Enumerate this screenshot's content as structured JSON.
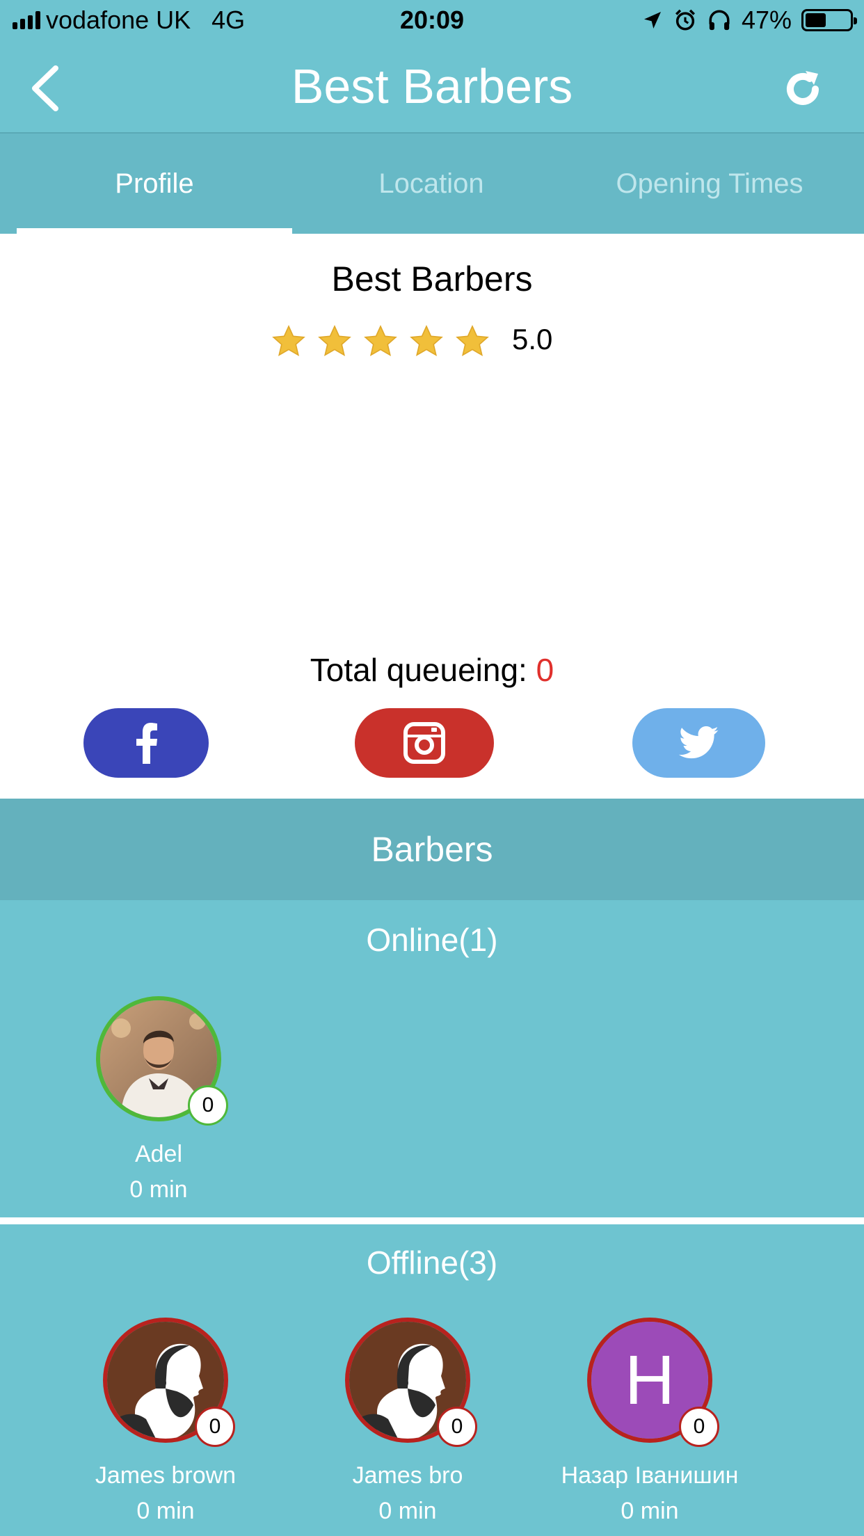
{
  "status_bar": {
    "carrier": "vodafone UK",
    "network": "4G",
    "time": "20:09",
    "battery": "47%",
    "battery_level": 0.47
  },
  "nav": {
    "title": "Best Barbers",
    "back_icon": "chevron-left-icon",
    "refresh_icon": "refresh-icon"
  },
  "tabs": [
    {
      "label": "Profile",
      "active": true
    },
    {
      "label": "Location",
      "active": false
    },
    {
      "label": "Opening Times",
      "active": false
    }
  ],
  "profile": {
    "name": "Best Barbers",
    "rating": "5.0",
    "stars": 5,
    "queue_label": "Total queueing: ",
    "queue_count": "0"
  },
  "social": {
    "facebook_icon": "facebook-icon",
    "instagram_icon": "instagram-icon",
    "twitter_icon": "twitter-icon"
  },
  "colors": {
    "primary": "#6ec4d0",
    "facebook": "#3a45b8",
    "instagram": "#c9312b",
    "twitter": "#6fb0ea",
    "online": "#4fb83a",
    "offline": "#b8221e",
    "queue_count": "#e0302c"
  },
  "barbers": {
    "title": "Barbers",
    "online_title": "Online(1)",
    "online": [
      {
        "name": "Adel",
        "wait": "0 min",
        "queue": "0"
      }
    ],
    "offline_title": "Offline(3)",
    "offline": [
      {
        "name": "James brown",
        "wait": "0 min",
        "queue": "0"
      },
      {
        "name": "James bro",
        "wait": "0 min",
        "queue": "0"
      },
      {
        "name": "Назар Іванишин",
        "wait": "0 min",
        "queue": "0",
        "initial": "H"
      }
    ]
  }
}
